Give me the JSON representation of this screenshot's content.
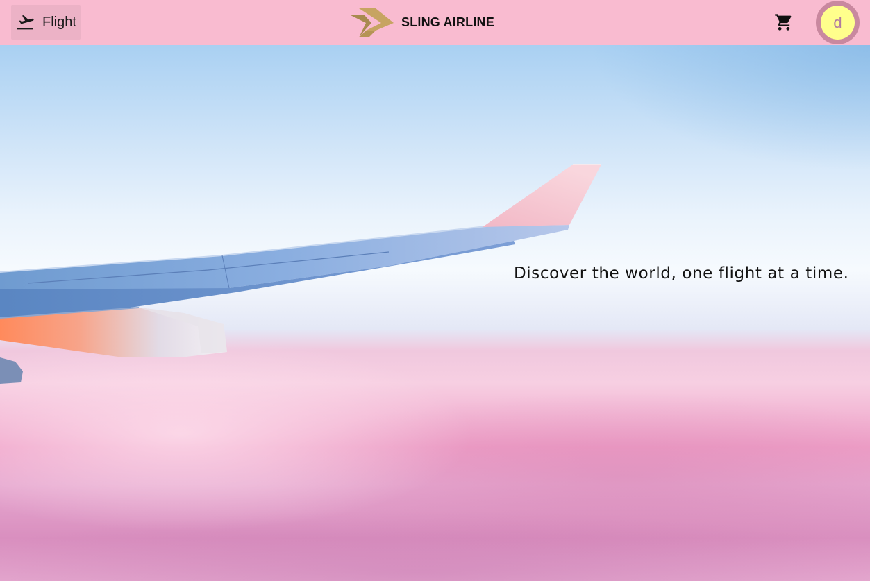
{
  "header": {
    "flight_button_label": "Flight",
    "brand_name": "SLING AIRLINE",
    "avatar_initial": "d",
    "icons": {
      "flight": "flight-takeoff-icon",
      "cart": "shopping-cart-icon",
      "logo": "sling-airline-logo"
    },
    "colors": {
      "header_bg": "#f9bbd0",
      "avatar_bg": "#ffff8c",
      "avatar_ring": "#c9889f",
      "logo_gold": "#c7a462"
    }
  },
  "hero": {
    "tagline": "Discover the world, one flight at a time."
  }
}
